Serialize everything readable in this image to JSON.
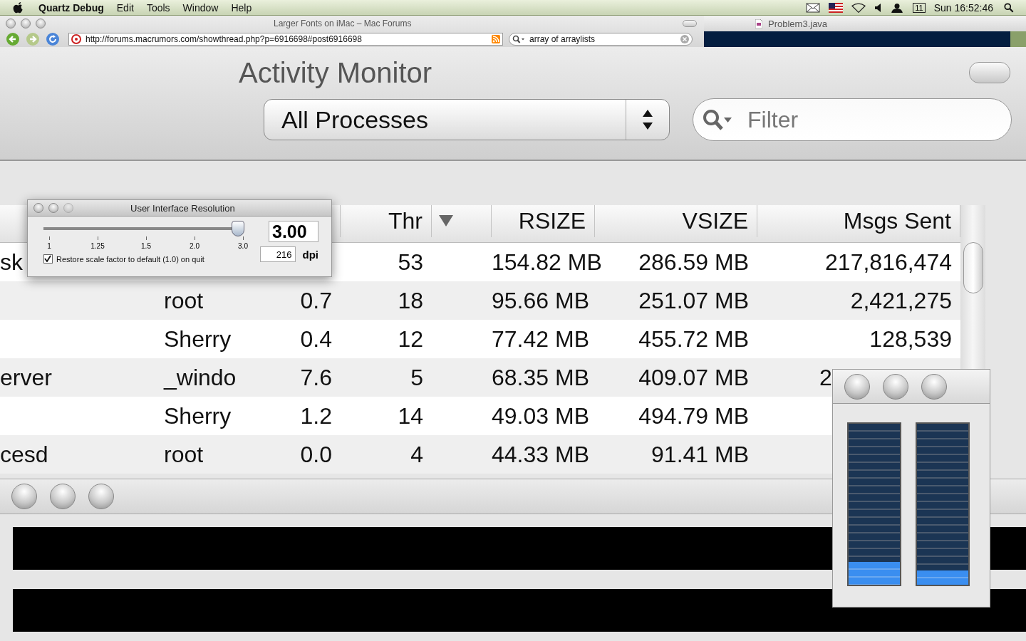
{
  "menu_bar": {
    "app": "Quartz Debug",
    "items": [
      "Edit",
      "Tools",
      "Window",
      "Help"
    ],
    "calendar_day": "11",
    "clock": "Sun 16:52:46"
  },
  "browser": {
    "title": "Larger Fonts on iMac – Mac Forums",
    "url": "http://forums.macrumors.com/showthread.php?p=6916698#post6916698",
    "search": {
      "value": "array of arraylists"
    }
  },
  "editor": {
    "title": "Problem3.java"
  },
  "activity_monitor": {
    "title": "Activity Monitor",
    "popup": {
      "value": "All Processes"
    },
    "filter": {
      "placeholder": "Filter"
    },
    "columns": [
      {
        "label": "Thr"
      },
      {
        "kind": "sort"
      },
      {
        "label": "RSIZE"
      },
      {
        "label": "VSIZE"
      },
      {
        "label": "Msgs Sent"
      }
    ],
    "rows": [
      {
        "name": "sk",
        "threads": "53",
        "rsize": "154.82 MB",
        "vsize": "286.59 MB",
        "msgs": "217,816,474",
        "selected": false
      },
      {
        "user": "root",
        "cpu": "0.7",
        "threads": "18",
        "rsize": "95.66 MB",
        "vsize": "251.07 MB",
        "msgs": "2,421,275",
        "selected": false
      },
      {
        "user": "Sherry",
        "cpu": "0.4",
        "threads": "12",
        "rsize": "77.42 MB",
        "vsize": "455.72 MB",
        "msgs": "128,539",
        "selected": false
      },
      {
        "name": "erver",
        "user": "_windo",
        "cpu": "7.6",
        "threads": "5",
        "rsize": "68.35 MB",
        "vsize": "409.07 MB",
        "msgs": "2",
        "msgs_partial": true,
        "selected": false
      },
      {
        "user": "Sherry",
        "cpu": "1.2",
        "threads": "14",
        "rsize": "49.03 MB",
        "vsize": "494.79 MB",
        "selected": false
      },
      {
        "name": "cesd",
        "user": "root",
        "cpu": "0.0",
        "threads": "4",
        "rsize": "44.33 MB",
        "vsize": "91.41 MB",
        "selected": false
      }
    ]
  },
  "resolution_dialog": {
    "title": "User Interface Resolution",
    "slider": {
      "level": 1.0,
      "ticks": [
        "1",
        "1.25",
        "1.5",
        "2.0",
        "3.0"
      ]
    },
    "scale": "3.00",
    "dpi": "216",
    "dpi_label": "dpi",
    "restore": {
      "label": "Restore scale factor to default (1.0) on quit",
      "checked": true
    }
  },
  "meter_window": {
    "meters": [
      {
        "level": 0.14
      },
      {
        "level": 0.09
      }
    ]
  }
}
